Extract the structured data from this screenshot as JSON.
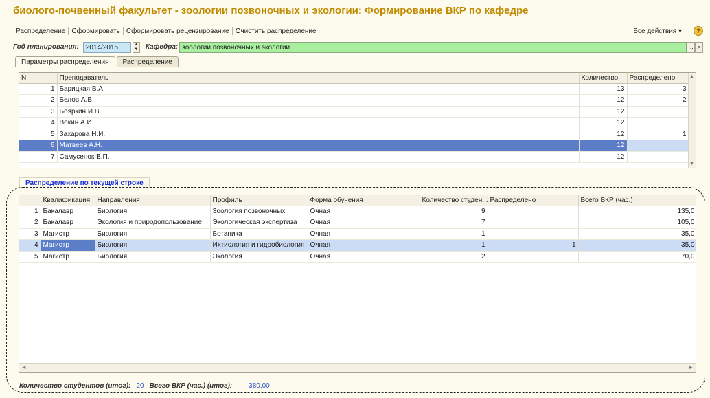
{
  "window": {
    "title": "биолого-почвенный факультет - зоологии позвоночных и экологии: Формирование ВКР по кафедре"
  },
  "toolbar": {
    "items": [
      "Распределение",
      "Сформировать",
      "Сформировать рецензирование",
      "Очистить распределение"
    ],
    "all_actions": "Все действия ▾",
    "help": "?"
  },
  "filters": {
    "year_label": "Год планирования:",
    "year_value": "2014/2015",
    "kafedra_label": "Кафедра:",
    "kafedra_value": "зоологии позвоночных и экологии",
    "select_btn": "..."
  },
  "tabs": [
    "Параметры распределения",
    "Распределение"
  ],
  "teachers": {
    "headers": [
      "N",
      "Преподаватель",
      "Количество",
      "Распределено"
    ],
    "rows": [
      [
        "1",
        "Барицкая В.А.",
        "13",
        "3"
      ],
      [
        "2",
        "Белов А.В.",
        "12",
        "2"
      ],
      [
        "3",
        "Бояркин И.В.",
        "12",
        ""
      ],
      [
        "4",
        "Вокин А.И.",
        "12",
        ""
      ],
      [
        "5",
        "Захарова Н.И.",
        "12",
        "1"
      ],
      [
        "6",
        "Матвеев А.Н.",
        "12",
        ""
      ],
      [
        "7",
        "Самусенок В.П.",
        "12",
        ""
      ]
    ],
    "selected_index": 5
  },
  "section_label": "Распределение по текущей строке",
  "distribution": {
    "headers": [
      "",
      "Квалификация",
      "Направления",
      "Профиль",
      "Форма обучения",
      "Количество студен...",
      "Распределено",
      "Всего ВКР (час.)"
    ],
    "rows": [
      [
        "1",
        "Бакалавр",
        "Биология",
        "Зоология позвоночных",
        "Очная",
        "9",
        "",
        "135,0"
      ],
      [
        "2",
        "Бакалавр",
        "Экология и природопользование",
        "Экологическая экспертиза",
        "Очная",
        "7",
        "",
        "105,0"
      ],
      [
        "3",
        "Магистр",
        "Биология",
        "Ботаника",
        "Очная",
        "1",
        "",
        "35,0"
      ],
      [
        "4",
        "Магистр",
        "Биология",
        "Ихтиология и гидробиология",
        "Очная",
        "1",
        "1",
        "35,0"
      ],
      [
        "5",
        "Магистр",
        "Биология",
        "Экология",
        "Очная",
        "2",
        "",
        "70,0"
      ]
    ],
    "selected_index": 3
  },
  "totals": {
    "students_label": "Количество студентов (итог):",
    "students_value": "20",
    "vkr_label": "Всего ВКР (час.) (итог):",
    "vkr_value": "380,00"
  }
}
